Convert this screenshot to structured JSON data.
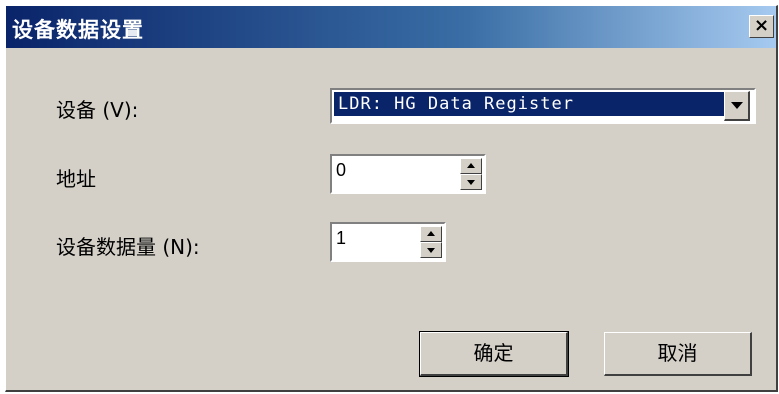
{
  "window": {
    "title": "设备数据设置",
    "close_glyph": "×"
  },
  "form": {
    "device_label": "设备 (V):",
    "device_value": "LDR: HG Data Register",
    "address_label": "地址",
    "address_value": "0",
    "count_label": "设备数据量 (N):",
    "count_value": "1"
  },
  "buttons": {
    "ok": "确定",
    "cancel": "取消"
  },
  "colors": {
    "titlebar_start": "#0a246a",
    "titlebar_end": "#a6caf0",
    "face": "#d4d0c8",
    "selection": "#0a246a"
  },
  "icons": {
    "close": "close-icon",
    "dropdown": "chevron-down-icon",
    "spin_up": "spin-up-icon",
    "spin_down": "spin-down-icon"
  }
}
